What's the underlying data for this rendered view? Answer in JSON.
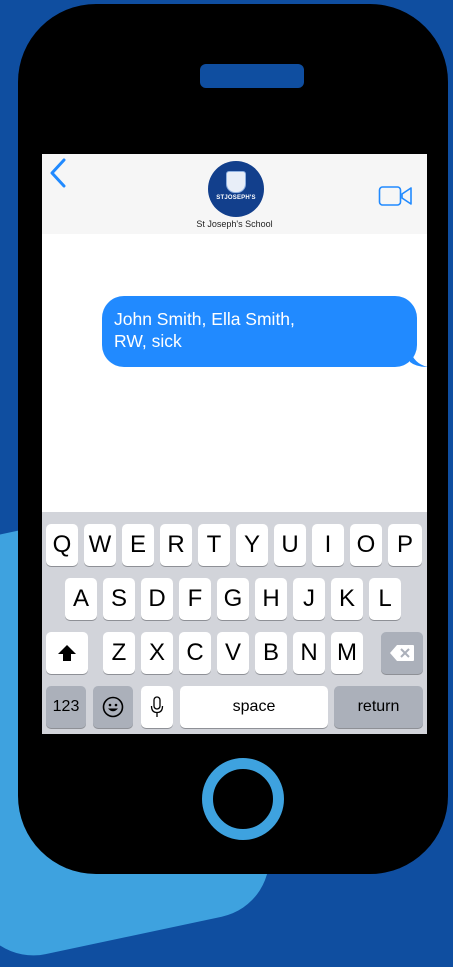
{
  "conversation": {
    "contact_name": "St Joseph's School",
    "avatar_logo_text": "STJOSEPH'S",
    "messages": [
      {
        "direction": "outgoing",
        "text_line1": "John Smith, Ella Smith,",
        "text_line2": "RW, sick"
      }
    ]
  },
  "keyboard": {
    "row1": [
      "Q",
      "W",
      "E",
      "R",
      "T",
      "Y",
      "U",
      "I",
      "O",
      "P"
    ],
    "row2": [
      "A",
      "S",
      "D",
      "F",
      "G",
      "H",
      "J",
      "K",
      "L"
    ],
    "row3": [
      "Z",
      "X",
      "C",
      "V",
      "B",
      "N",
      "M"
    ],
    "numbers_key": "123",
    "space_key": "space",
    "return_key": "return"
  },
  "icons": {
    "back": "chevron-left-icon",
    "video": "video-camera-icon",
    "shift": "shift-arrow-icon",
    "delete": "backspace-icon",
    "emoji": "emoji-icon",
    "mic": "microphone-icon"
  },
  "colors": {
    "background": "#0f4ea0",
    "accent": "#3ea2df",
    "bubble": "#218aff",
    "ios_blue": "#218aff"
  }
}
